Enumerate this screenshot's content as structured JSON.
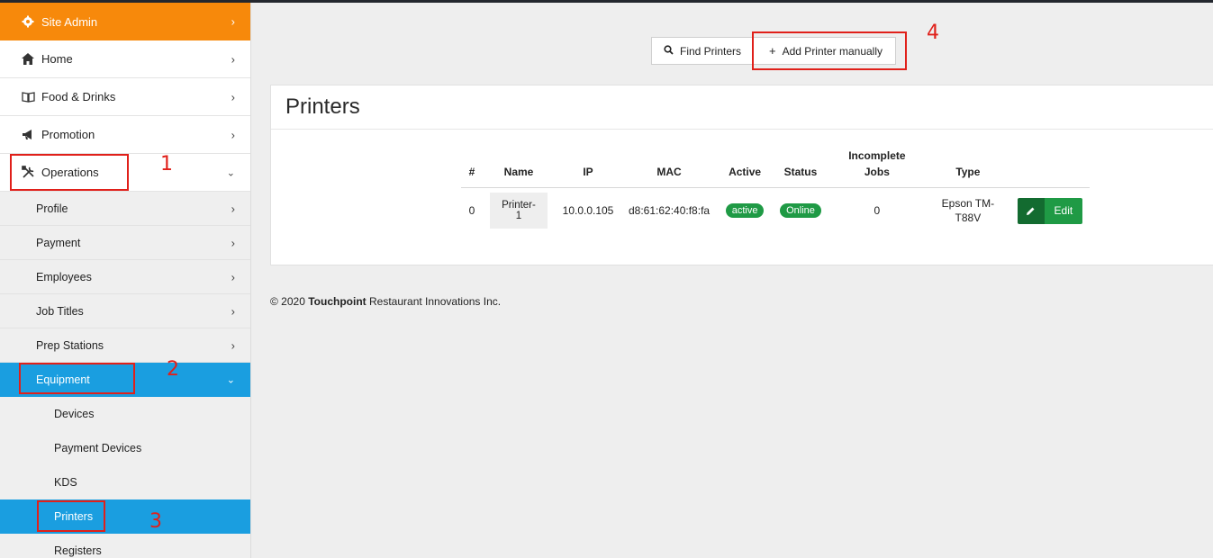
{
  "sidebar": {
    "site_admin": "Site Admin",
    "home": "Home",
    "food_drinks": "Food & Drinks",
    "promotion": "Promotion",
    "operations": "Operations",
    "sub": {
      "profile": "Profile",
      "payment": "Payment",
      "employees": "Employees",
      "job_titles": "Job Titles",
      "prep_stations": "Prep Stations",
      "equipment": "Equipment"
    },
    "equipment_items": {
      "devices": "Devices",
      "payment_devices": "Payment Devices",
      "kds": "KDS",
      "printers": "Printers",
      "registers": "Registers"
    }
  },
  "toolbar": {
    "find_printers": "Find Printers",
    "add_printer_manually": "Add Printer manually"
  },
  "annotations": {
    "n1": "1",
    "n2": "2",
    "n3": "3",
    "n4": "4"
  },
  "panel": {
    "title": "Printers"
  },
  "table": {
    "headers": {
      "num": "#",
      "name": "Name",
      "ip": "IP",
      "mac": "MAC",
      "active": "Active",
      "status": "Status",
      "incomplete_line1": "Incomplete",
      "incomplete_line2": "Jobs",
      "type": "Type"
    },
    "rows": [
      {
        "num": "0",
        "name": "Printer-1",
        "ip": "10.0.0.105",
        "mac": "d8:61:62:40:f8:fa",
        "active": "active",
        "status": "Online",
        "incomplete": "0",
        "type_line1": "Epson TM-",
        "type_line2": "T88V",
        "edit": "Edit"
      }
    ]
  },
  "footer": {
    "prefix": "© 2020",
    "brand": "Touchpoint",
    "suffix": "Restaurant Innovations Inc."
  },
  "colors": {
    "orange": "#f7890b",
    "blue": "#1a9ee0",
    "green": "#1f9a45",
    "dark_green": "#136b30",
    "annotation_red": "#e0201a"
  }
}
